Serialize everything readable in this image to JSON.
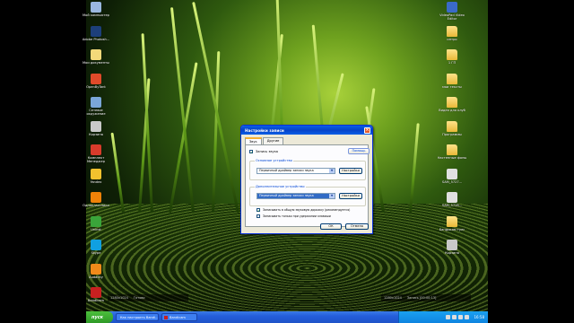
{
  "desktop": {
    "left_icons": [
      {
        "label": "Мой компьютер",
        "color": "#9ab7e0",
        "icon": "computer-icon"
      },
      {
        "label": "Adobe Photosh...",
        "color": "#1d3f7a",
        "icon": "photoshop-icon"
      },
      {
        "label": "Мои документы",
        "color": "#f3d97a",
        "icon": "documents-icon"
      },
      {
        "label": "OpenByTant",
        "color": "#e04a2a",
        "icon": "app-icon"
      },
      {
        "label": "Сетевое окружение",
        "color": "#7aa6d8",
        "icon": "network-icon"
      },
      {
        "label": "Корзина",
        "color": "#c9c9c9",
        "icon": "recycle-bin-icon"
      },
      {
        "label": "Комплект Менеджер",
        "color": "#d83b2b",
        "icon": "manager-icon"
      },
      {
        "label": "Yandex",
        "color": "#f2c12e",
        "icon": "yandex-icon"
      },
      {
        "label": "Одноклассники",
        "color": "#ee8208",
        "icon": "odnoklassniki-icon"
      },
      {
        "label": "Uninst",
        "color": "#3aa53a",
        "icon": "uninstall-icon"
      },
      {
        "label": "Skype",
        "color": "#10a0e0",
        "icon": "skype-icon"
      },
      {
        "label": "Audacity",
        "color": "#f08a1a",
        "icon": "audacity-icon"
      },
      {
        "label": "Bandicam",
        "color": "#c82020",
        "icon": "bandicam-icon"
      },
      {
        "label": "Bandicam",
        "color": "#c82020",
        "icon": "bandicam-icon"
      }
    ],
    "right_icons": [
      {
        "label": "VideoPad Video Editor",
        "color": "#3a6ac8",
        "icon": "videopad-icon"
      },
      {
        "label": "интро",
        "color": "#f3d97a",
        "icon": "folder-icon"
      },
      {
        "label": "1 ГП",
        "color": "#f3d97a",
        "icon": "folder-icon"
      },
      {
        "label": "мои тексты",
        "color": "#f3d97a",
        "icon": "folder-icon"
      },
      {
        "label": "Видео для клуб",
        "color": "#f3d97a",
        "icon": "folder-icon"
      },
      {
        "label": "Программы",
        "color": "#f3d97a",
        "icon": "folder-icon"
      },
      {
        "label": "Настенные фоны",
        "color": "#f3d97a",
        "icon": "folder-icon"
      },
      {
        "label": "SAM_5727...",
        "color": "#e0e0e0",
        "icon": "file-icon"
      },
      {
        "label": "SAM_5728...",
        "color": "#e0e0e0",
        "icon": "file-icon"
      },
      {
        "label": "Бандикам тулс",
        "color": "#f3d97a",
        "icon": "folder-icon"
      },
      {
        "label": "Корзина",
        "color": "#c9c9c9",
        "icon": "recycle-bin-icon"
      }
    ]
  },
  "overlay": {
    "left_res": "1280x1024",
    "left_status": "Готово",
    "right_res": "1280x1024",
    "right_status": "Запись [00:00:13]"
  },
  "dialog": {
    "title": "Настройки записи",
    "close": "×",
    "tabs": [
      "Звук",
      "Другие"
    ],
    "record_sound_label": "Запись звука",
    "record_sound_checked": "✓",
    "help_button": "Помощь",
    "primary_group_label": "Основное устройство",
    "primary_device": "Первичный драйвер записи звука",
    "settings_button": "Настройки",
    "secondary_group_label": "Дополнительное устройство",
    "secondary_device": "Первичный драйвер записи звука",
    "settings_button_2": "Настройки",
    "mix_label": "Записывать в общую звуковую дорожку (рекомендуется)",
    "mix_checked": "✓",
    "ctrl_label": "Записывать только при удержании клавиши",
    "ok": "ОК",
    "cancel": "Отмена"
  },
  "taskbar": {
    "start": "пуск",
    "buttons": [
      "Как настроить Bandi...",
      "Bandicam"
    ],
    "clock": "16:58"
  }
}
